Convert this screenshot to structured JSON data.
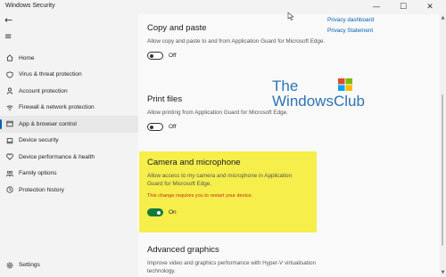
{
  "window": {
    "title": "Windows Security",
    "minimize": "—",
    "maximize": "☐",
    "close": "✕"
  },
  "sidebar": {
    "back": "←",
    "menu": "≡",
    "items": [
      {
        "label": "Home",
        "icon": "home-icon"
      },
      {
        "label": "Virus & threat protection",
        "icon": "shield-icon"
      },
      {
        "label": "Account protection",
        "icon": "person-icon"
      },
      {
        "label": "Firewall & network protection",
        "icon": "wifi-icon"
      },
      {
        "label": "App & browser control",
        "icon": "app-window-icon",
        "active": true
      },
      {
        "label": "Device security",
        "icon": "laptop-icon"
      },
      {
        "label": "Device performance & health",
        "icon": "heart-icon"
      },
      {
        "label": "Family options",
        "icon": "family-icon"
      },
      {
        "label": "Protection history",
        "icon": "history-icon"
      }
    ],
    "settings": "Settings"
  },
  "main": {
    "sections": [
      {
        "title": "Copy and paste",
        "description": "Allow copy and paste to and from Application Guard for Microsoft Edge.",
        "toggle_state": "Off"
      },
      {
        "title": "Print files",
        "description": "Allow printing from Application Guard for Microsoft Edge.",
        "toggle_state": "Off"
      },
      {
        "title": "Camera and microphone",
        "description": "Allow access to my camera and microphone in Application Guard for Microsoft Edge.",
        "warning": "This change requires you to restart your device.",
        "toggle_state": "On"
      },
      {
        "title": "Advanced graphics",
        "description": "Improve video and graphics performance with Hyper-V virtualisation technology."
      }
    ]
  },
  "links": {
    "privacy_dashboard": "Privacy dashboard",
    "privacy_statement": "Privacy Statement"
  },
  "watermark": {
    "line1": "The",
    "line2": "WindowsClub"
  },
  "colors": {
    "accent": "#005fb8",
    "toggle_on": "#0f7b3e",
    "highlight": "#f6ee4b",
    "warning": "#c42b1c"
  }
}
